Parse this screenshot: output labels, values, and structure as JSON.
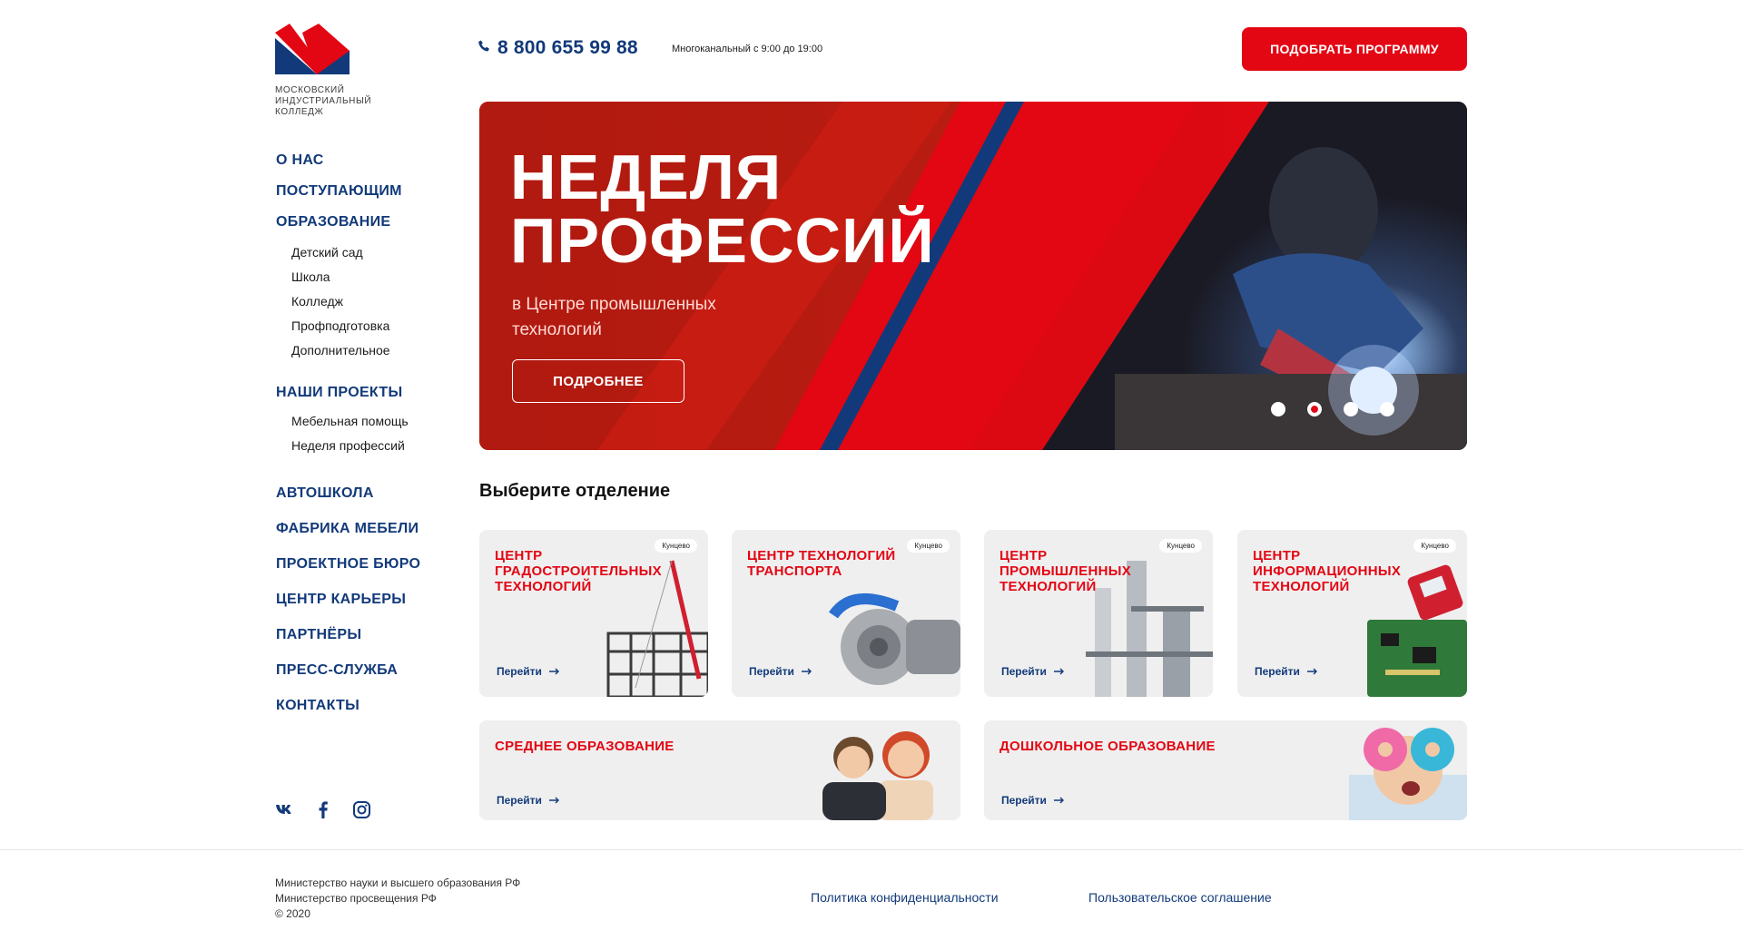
{
  "logo": {
    "text_lines": [
      "МОСКОВСКИЙ",
      "ИНДУСТРИАЛЬНЫЙ",
      "КОЛЛЕДЖ"
    ]
  },
  "header": {
    "phone": "8 800 655 99 88",
    "phone_note": "Многоканальный с 9:00 до 19:00",
    "cta_label": "ПОДОБРАТЬ ПРОГРАММУ"
  },
  "sidebar": {
    "about": "О НАС",
    "applicants": "ПОСТУПАЮЩИМ",
    "education": "ОБРАЗОВАНИЕ",
    "education_items": [
      "Детский сад",
      "Школа",
      "Колледж",
      "Профподготовка",
      "Дополнительное"
    ],
    "projects": "НАШИ ПРОЕКТЫ",
    "project_items": [
      "Мебельная помощь",
      "Неделя профессий"
    ],
    "more": [
      "АВТОШКОЛА",
      "ФАБРИКА МЕБЕЛИ",
      "ПРОЕКТНОЕ БЮРО",
      "ЦЕНТР КАРЬЕРЫ",
      "ПАРТНЁРЫ",
      "ПРЕСС-СЛУЖБА",
      "КОНТАКТЫ"
    ],
    "social_icons": [
      "vk-icon",
      "facebook-icon",
      "instagram-icon"
    ]
  },
  "hero": {
    "title_line1": "НЕДЕЛЯ",
    "title_line2": "ПРОФЕССИЙ",
    "subtitle": "в Центре промышленных технологий",
    "button": "ПОДРОБНЕЕ",
    "slides": 4,
    "active_slide": 2
  },
  "section": {
    "title": "Выберите отделение",
    "link_label": "Перейти",
    "cards": [
      {
        "title": "ЦЕНТР ГРАДОСТРОИТЕЛЬНЫХ ТЕХНОЛОГИЙ",
        "badge": "Кунцево"
      },
      {
        "title": "ЦЕНТР ТЕХНОЛОГИЙ ТРАНСПОРТА",
        "badge": "Кунцево"
      },
      {
        "title": "ЦЕНТР ПРОМЫШЛЕННЫХ ТЕХНОЛОГИЙ",
        "badge": "Кунцево"
      },
      {
        "title": "ЦЕНТР ИНФОРМАЦИОННЫХ ТЕХНОЛОГИЙ",
        "badge": "Кунцево"
      }
    ],
    "wide_cards": [
      {
        "title": "СРЕДНЕЕ ОБРАЗОВАНИЕ"
      },
      {
        "title": "ДОШКОЛЬНОЕ ОБРАЗОВАНИЕ"
      }
    ]
  },
  "footer": {
    "lines": [
      "Министерство науки и высшего образования РФ",
      "Министерство просвещения РФ",
      "© 2020"
    ],
    "privacy": "Политика конфиденциальности",
    "terms": "Пользовательское соглашение"
  },
  "colors": {
    "accent_red": "#e30613",
    "brand_blue": "#123a7a",
    "card_bg": "#efefef"
  }
}
